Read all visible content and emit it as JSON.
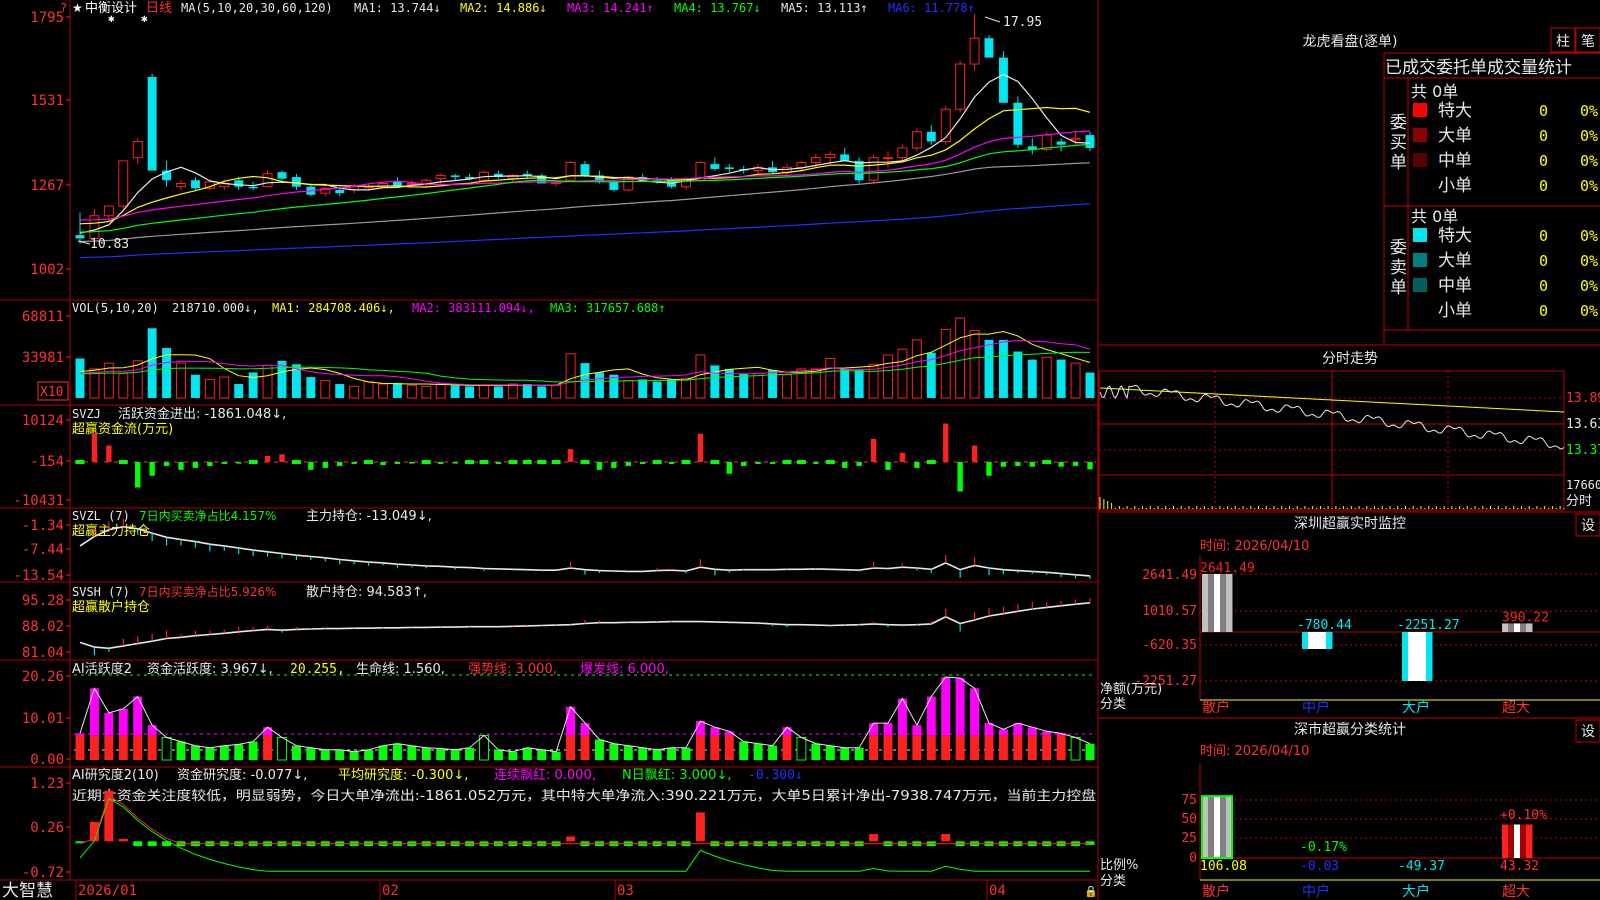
{
  "colors": {
    "up": "#ff2020",
    "down": "#00e5ee",
    "grid": "#8b0000",
    "axis": "#ff3030",
    "white": "#e8e8e8",
    "yellow": "#ffff00",
    "magenta": "#ff00ff",
    "green": "#00ff00",
    "gray": "#9a9a9a",
    "blue": "#2030ff"
  },
  "header": {
    "star": "★",
    "name": "中衡设计",
    "period": "日线",
    "ma_label": "MA(5,10,20,30,60,120)",
    "ma1": "MA1: 13.744↓",
    "ma2": "MA2: 14.886↓",
    "ma3": "MA3: 14.241↑",
    "ma4": "MA4: 13.767↓",
    "ma5": "MA5: 13.113↑",
    "ma6": "MA6: 11.778↑",
    "high_mark": "17.95",
    "low_mark": "10.83",
    "question": "?"
  },
  "price_axis": [
    "1795",
    "1531",
    "1267",
    "1002"
  ],
  "vol": {
    "label": "VOL(5,10,20)",
    "value": "218710.000↓,",
    "ma1": "MA1: 284708.406↓,",
    "ma2": "MA2: 383111.094↓,",
    "ma3": "MA3: 317657.688↑",
    "axis": [
      "68811",
      "33981"
    ],
    "unit": "X10"
  },
  "svzj": {
    "label": "SVZJ",
    "desc": "活跃资金进出: -1861.048↓,",
    "title": "超赢资金流(万元)",
    "axis": [
      "10124",
      "-154",
      "-10431"
    ]
  },
  "svzl": {
    "label": "SVZL (7)",
    "desc1": "7日内买卖净占比4.157%",
    "desc2": "主力持仓: -13.049↓,",
    "title": "超赢主力持仓",
    "axis": [
      "-1.34",
      "-7.44",
      "-13.54"
    ]
  },
  "svsh": {
    "label": "SVSH (7)",
    "desc1": "7日内买卖净占比5.926%",
    "desc2": "散户持仓: 94.583↑,",
    "title": "超赢散户持仓",
    "axis": [
      "95.28",
      "88.02",
      "81.04"
    ]
  },
  "ai1": {
    "label": "AI活跃度2",
    "desc1": "资金活跃度: 3.967↓,",
    "desc2": "20.255,",
    "desc3": "生命线: 1.560,",
    "desc4": "强势线: 3.000,",
    "desc5": "爆发线: 6.000,",
    "axis": [
      "20.26",
      "10.01",
      "0.00"
    ]
  },
  "ai2": {
    "label": "AI研究度2(10)",
    "desc1": "资金研究度: -0.077↓,",
    "desc2": "平均研究度: -0.300↓,",
    "desc3": "连续飘红: 0.000,",
    "desc4": "N日飘红: 3.000↓,",
    "desc5": "-0.300↓",
    "text": "近期大资金关注度较低，明显弱势，今日大单净流出:-1861.052万元，其中特大单净流入:390.221万元，大单5日累计净出-7938.747万元，当前主力控盘",
    "axis": [
      "1.23",
      "0.26",
      "-0.72"
    ]
  },
  "footer": {
    "brand": "大智慧",
    "dates": [
      "2026/01",
      "02",
      "03",
      "04"
    ]
  },
  "lhb": {
    "title": "龙虎看盘(逐单)",
    "tab1": "柱",
    "tab2": "笔",
    "tabs": [
      "已成交",
      "委托单",
      "成交量",
      "统计"
    ],
    "buy_title": "委买单",
    "sell_title": "委卖单",
    "buy_total": "共 0单",
    "sell_total": "共 0单",
    "rows": [
      {
        "name": "特大",
        "count": "0",
        "pct": "0%"
      },
      {
        "name": "大单",
        "count": "0",
        "pct": "0%"
      },
      {
        "name": "中单",
        "count": "0",
        "pct": "0%"
      },
      {
        "name": "小单",
        "count": "0",
        "pct": "0%"
      }
    ],
    "buy_colors": [
      "#ff0000",
      "#8b0000",
      "#5a0000",
      "#000000"
    ],
    "sell_colors": [
      "#00e5ee",
      "#007f7f",
      "#006060",
      "#000000"
    ]
  },
  "intraday": {
    "title": "分时走势",
    "axis": [
      "13.89",
      "13.63",
      "13.37"
    ],
    "vol_axis": "17660",
    "unit": "分时"
  },
  "monitor": {
    "title": "深圳超赢实时监控",
    "set": "设",
    "time": "时间: 2026/04/10",
    "axis": [
      "2641.49",
      "1010.57",
      "-620.35",
      "-2251.27"
    ],
    "values": [
      "2641.49",
      "-780.44",
      "-2251.27",
      "390.22"
    ],
    "ylabel1": "净额(万元)",
    "ylabel2": "分类",
    "cats": [
      "散户",
      "中户",
      "大户",
      "超大"
    ]
  },
  "classify": {
    "title": "深市超赢分类统计",
    "set": "设",
    "time": "时间: 2026/04/10",
    "axis": [
      "75",
      "50",
      "25",
      "0"
    ],
    "pct_labels": [
      "-0.17%",
      "+0.10%"
    ],
    "values": [
      "106.08",
      "-0.03",
      "-49.37",
      "43.32"
    ],
    "ylabel1": "比例%",
    "ylabel2": "分类",
    "cats": [
      "散户",
      "中户",
      "大户",
      "超大"
    ]
  },
  "chart_data": [
    {
      "type": "candlestick",
      "title": "中衡设计 日线",
      "x_range": [
        "2026/01",
        "04"
      ],
      "ylim": [
        10.02,
        17.95
      ],
      "ohlc": [
        [
          11.1,
          11.8,
          10.83,
          11.0
        ],
        [
          11.0,
          11.9,
          10.9,
          11.7
        ],
        [
          11.7,
          12.0,
          11.5,
          12.0
        ],
        [
          12.0,
          13.4,
          11.9,
          13.4
        ],
        [
          13.5,
          14.1,
          13.3,
          14.0
        ],
        [
          16.0,
          16.1,
          13.1,
          13.1
        ],
        [
          13.1,
          13.4,
          12.6,
          12.8
        ],
        [
          12.6,
          12.8,
          12.5,
          12.7
        ],
        [
          12.8,
          12.9,
          12.5,
          12.55
        ],
        [
          12.55,
          12.8,
          12.5,
          12.75
        ],
        [
          12.6,
          12.8,
          12.5,
          12.7
        ],
        [
          12.8,
          12.9,
          12.5,
          12.6
        ],
        [
          12.6,
          12.75,
          12.5,
          12.55
        ],
        [
          12.6,
          13.1,
          12.6,
          13.0
        ],
        [
          13.05,
          13.1,
          12.8,
          12.85
        ],
        [
          12.9,
          13.0,
          12.5,
          12.6
        ],
        [
          12.6,
          12.7,
          12.3,
          12.35
        ],
        [
          12.4,
          12.6,
          12.3,
          12.55
        ],
        [
          12.5,
          12.6,
          12.3,
          12.4
        ],
        [
          12.5,
          12.7,
          12.4,
          12.6
        ],
        [
          12.6,
          12.7,
          12.5,
          12.6
        ],
        [
          12.6,
          12.75,
          12.55,
          12.7
        ],
        [
          12.75,
          12.9,
          12.6,
          12.6
        ],
        [
          12.7,
          12.8,
          12.6,
          12.7
        ],
        [
          12.7,
          12.85,
          12.6,
          12.8
        ],
        [
          12.85,
          13.0,
          12.7,
          12.95
        ],
        [
          12.95,
          13.0,
          12.8,
          12.9
        ],
        [
          12.9,
          13.0,
          12.8,
          12.85
        ],
        [
          12.8,
          13.1,
          12.75,
          13.05
        ],
        [
          13.0,
          13.1,
          12.85,
          12.9
        ],
        [
          12.85,
          13.0,
          12.75,
          12.95
        ],
        [
          13.0,
          13.1,
          12.85,
          12.95
        ],
        [
          12.95,
          13.0,
          12.7,
          12.7
        ],
        [
          12.7,
          12.8,
          12.6,
          12.75
        ],
        [
          12.8,
          13.4,
          12.75,
          13.35
        ],
        [
          13.3,
          13.4,
          12.9,
          12.95
        ],
        [
          12.95,
          13.1,
          12.7,
          12.75
        ],
        [
          12.75,
          12.8,
          12.45,
          12.5
        ],
        [
          12.5,
          12.9,
          12.45,
          12.9
        ],
        [
          12.9,
          13.0,
          12.75,
          12.8
        ],
        [
          12.8,
          12.9,
          12.7,
          12.75
        ],
        [
          12.8,
          12.9,
          12.55,
          12.6
        ],
        [
          12.6,
          12.9,
          12.5,
          12.85
        ],
        [
          12.8,
          13.4,
          12.8,
          13.35
        ],
        [
          13.3,
          13.5,
          13.1,
          13.15
        ],
        [
          13.2,
          13.3,
          13.05,
          13.15
        ],
        [
          13.15,
          13.25,
          13.0,
          13.1
        ],
        [
          13.1,
          13.3,
          13.0,
          13.2
        ],
        [
          13.2,
          13.4,
          13.0,
          13.05
        ],
        [
          13.05,
          13.3,
          12.9,
          13.2
        ],
        [
          13.2,
          13.4,
          13.1,
          13.35
        ],
        [
          13.35,
          13.6,
          13.2,
          13.5
        ],
        [
          13.5,
          13.7,
          13.3,
          13.6
        ],
        [
          13.6,
          13.8,
          13.4,
          13.4
        ],
        [
          13.4,
          13.5,
          12.7,
          12.8
        ],
        [
          12.8,
          13.6,
          12.7,
          13.5
        ],
        [
          13.5,
          13.7,
          13.2,
          13.5
        ],
        [
          13.5,
          13.9,
          13.4,
          13.8
        ],
        [
          13.8,
          14.4,
          13.7,
          14.3
        ],
        [
          14.3,
          14.5,
          13.9,
          14.0
        ],
        [
          14.0,
          15.1,
          13.9,
          15.0
        ],
        [
          15.0,
          16.5,
          14.9,
          16.4
        ],
        [
          16.4,
          17.95,
          16.2,
          17.2
        ],
        [
          17.2,
          17.3,
          16.6,
          16.6
        ],
        [
          16.6,
          16.8,
          15.2,
          15.2
        ],
        [
          15.2,
          15.4,
          13.8,
          13.9
        ],
        [
          13.85,
          14.1,
          13.6,
          13.75
        ],
        [
          13.75,
          14.3,
          13.7,
          14.2
        ],
        [
          14.0,
          14.1,
          13.7,
          13.9
        ],
        [
          14.05,
          14.3,
          13.9,
          14.1
        ],
        [
          14.2,
          14.3,
          13.7,
          13.8
        ]
      ]
    },
    {
      "type": "bar",
      "title": "VOL(5,10,20)",
      "ylim": [
        0,
        68811
      ],
      "values": [
        34000,
        25000,
        30000,
        21000,
        32000,
        60000,
        43000,
        30000,
        20000,
        16000,
        18000,
        12000,
        22000,
        28000,
        32000,
        29000,
        18000,
        15000,
        12000,
        10000,
        14000,
        12000,
        13000,
        11000,
        10000,
        12000,
        11000,
        10000,
        11000,
        10000,
        12000,
        12000,
        10000,
        11000,
        38000,
        30000,
        22000,
        20000,
        15000,
        16000,
        14000,
        16000,
        17000,
        37000,
        28000,
        25000,
        21000,
        21000,
        24000,
        20000,
        25000,
        25000,
        34000,
        25000,
        24000,
        29000,
        37000,
        42000,
        50000,
        39000,
        59000,
        68811,
        58000,
        50000,
        50000,
        40000,
        33000,
        35000,
        33000,
        30000,
        21871
      ]
    },
    {
      "type": "bar",
      "title": "超赢资金流(万元)",
      "ylim": [
        -10431,
        10124
      ],
      "values": [
        0,
        5500,
        3200,
        0,
        -6500,
        -3500,
        -1000,
        -2000,
        -1500,
        -1000,
        -500,
        -400,
        0,
        1200,
        1500,
        0,
        -2000,
        -1500,
        -1000,
        -500,
        0,
        -800,
        -500,
        -400,
        0,
        -500,
        -400,
        0,
        0,
        -500,
        0,
        0,
        0,
        0,
        2500,
        0,
        -2000,
        -1500,
        -1000,
        -500,
        0,
        -500,
        0,
        5500,
        0,
        -3000,
        -1000,
        -500,
        -500,
        0,
        0,
        -500,
        0,
        -1500,
        -1000,
        4500,
        -2000,
        1800,
        -1500,
        0,
        7500,
        -7500,
        3200,
        -3500,
        -1200,
        -1000,
        -1200,
        0,
        -1200,
        -1000,
        -1861
      ]
    },
    {
      "type": "line",
      "title": "超赢主力持仓",
      "ylim": [
        -13.54,
        -1.34
      ],
      "values": [
        -6.0,
        -3.8,
        -2.2,
        -1.5,
        -2.0,
        -3.0,
        -4.0,
        -4.5,
        -5.0,
        -5.6,
        -6.0,
        -6.5,
        -7.0,
        -7.4,
        -7.8,
        -8.2,
        -8.5,
        -8.8,
        -9.2,
        -9.5,
        -9.8,
        -10.0,
        -10.3,
        -10.5,
        -10.7,
        -10.8,
        -11.0,
        -11.1,
        -11.3,
        -11.4,
        -11.5,
        -11.6,
        -11.7,
        -11.7,
        -11.2,
        -11.6,
        -11.8,
        -11.9,
        -12.0,
        -12.0,
        -11.8,
        -11.7,
        -11.9,
        -11.0,
        -11.5,
        -11.7,
        -11.6,
        -11.6,
        -11.6,
        -11.5,
        -11.5,
        -11.4,
        -11.5,
        -11.6,
        -11.7,
        -11.2,
        -11.3,
        -11.0,
        -11.2,
        -11.5,
        -10.0,
        -11.6,
        -10.6,
        -11.2,
        -11.6,
        -11.8,
        -12.0,
        -12.2,
        -12.5,
        -12.8,
        -13.05
      ]
    },
    {
      "type": "line",
      "title": "超赢散户持仓",
      "ylim": [
        81.04,
        95.28
      ],
      "values": [
        84.5,
        83.3,
        83.0,
        83.6,
        84.2,
        84.8,
        85.5,
        85.8,
        86.2,
        86.5,
        86.8,
        87.2,
        87.5,
        87.8,
        87.6,
        87.8,
        87.9,
        88.0,
        88.0,
        88.1,
        88.1,
        88.2,
        88.2,
        88.3,
        88.3,
        88.4,
        88.4,
        88.5,
        88.5,
        88.5,
        88.6,
        88.7,
        88.8,
        88.9,
        89.0,
        89.3,
        89.5,
        89.5,
        89.6,
        89.6,
        89.7,
        89.8,
        89.8,
        89.8,
        89.7,
        89.6,
        89.5,
        89.4,
        89.2,
        89.0,
        89.0,
        88.9,
        88.8,
        88.9,
        89.0,
        89.2,
        89.0,
        88.9,
        89.0,
        89.2,
        91.0,
        89.3,
        90.2,
        91.2,
        91.8,
        92.4,
        93.0,
        93.4,
        93.8,
        94.2,
        94.58
      ]
    },
    {
      "type": "bar",
      "title": "AI活跃度2",
      "ylim": [
        0,
        20.26
      ],
      "values": [
        6.5,
        17.5,
        11.5,
        12.5,
        15.5,
        8.5,
        5.5,
        4.5,
        3.5,
        3.0,
        3.5,
        3.8,
        4.5,
        8.0,
        5.5,
        3.5,
        3.0,
        2.5,
        2.5,
        2.0,
        2.5,
        3.5,
        4.0,
        3.5,
        3.0,
        2.8,
        2.5,
        3.0,
        6.0,
        2.5,
        2.0,
        3.0,
        2.5,
        2.0,
        13.0,
        9.0,
        5.0,
        4.0,
        3.5,
        3.0,
        2.5,
        3.0,
        3.0,
        9.5,
        8.0,
        7.0,
        4.5,
        4.0,
        3.5,
        8.0,
        5.5,
        4.0,
        3.5,
        3.0,
        3.0,
        9.0,
        9.0,
        15.0,
        8.5,
        15.5,
        20.255,
        20.0,
        17.5,
        9.0,
        7.5,
        9.0,
        8.0,
        7.0,
        6.5,
        5.5,
        3.967
      ]
    },
    {
      "type": "bar",
      "title": "AI研究度2(10)",
      "ylim": [
        -0.72,
        1.23
      ],
      "values": [
        0.0,
        0.4,
        1.05,
        0.05,
        -0.1,
        -0.1,
        -0.1,
        -0.1,
        -0.1,
        -0.1,
        -0.1,
        -0.1,
        -0.1,
        -0.1,
        -0.1,
        -0.1,
        -0.1,
        -0.1,
        -0.1,
        -0.1,
        -0.1,
        -0.1,
        -0.1,
        -0.1,
        -0.1,
        -0.1,
        -0.1,
        -0.1,
        -0.1,
        -0.1,
        -0.1,
        -0.1,
        -0.1,
        -0.1,
        0.1,
        -0.1,
        -0.1,
        -0.1,
        -0.1,
        -0.1,
        -0.1,
        -0.1,
        -0.1,
        0.6,
        -0.1,
        -0.1,
        -0.1,
        -0.1,
        -0.1,
        -0.1,
        -0.1,
        -0.1,
        -0.1,
        -0.1,
        -0.1,
        0.15,
        -0.1,
        -0.1,
        -0.1,
        -0.1,
        0.15,
        -0.1,
        -0.1,
        -0.1,
        -0.1,
        -0.1,
        -0.1,
        -0.1,
        -0.1,
        -0.1,
        -0.077
      ]
    },
    {
      "type": "bar",
      "title": "深圳超赢实时监控",
      "categories": [
        "散户",
        "中户",
        "大户",
        "超大"
      ],
      "values": [
        2641.49,
        -780.44,
        -2251.27,
        390.22
      ],
      "ylim": [
        -2251.27,
        2641.49
      ]
    },
    {
      "type": "bar",
      "title": "深市超赢分类统计",
      "categories": [
        "散户",
        "中户",
        "大户",
        "超大"
      ],
      "values": [
        106.08,
        -0.03,
        -49.37,
        43.32
      ],
      "ylim": [
        0,
        75
      ]
    }
  ]
}
